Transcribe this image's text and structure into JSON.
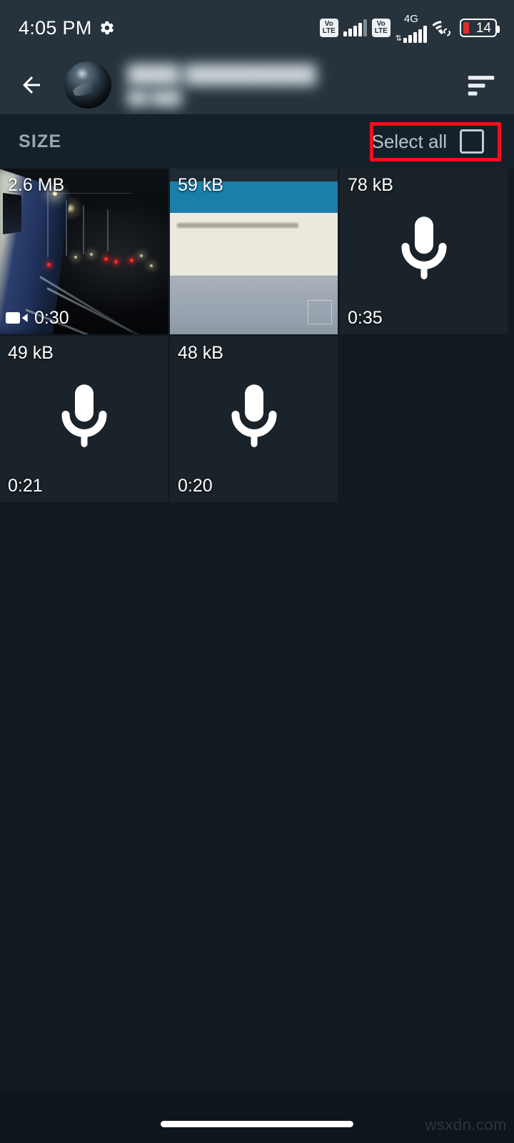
{
  "status_bar": {
    "time": "4:05 PM",
    "gear_icon": "gear-icon",
    "volte_top": "Vo",
    "volte_bottom": "LTE",
    "network_type": "4G",
    "wifi_icon": "wifi-icon",
    "battery_percent": "14"
  },
  "app_bar": {
    "back_icon": "back-arrow-icon",
    "avatar": "contact-avatar",
    "title": "",
    "subtitle": "",
    "sort_icon": "sort-icon"
  },
  "section": {
    "size_label": "SIZE",
    "select_all_label": "Select all",
    "checkbox_state": "unchecked",
    "annotation_color": "#fb0d1b"
  },
  "media": {
    "tiles": [
      {
        "size": "2.6 MB",
        "duration": "0:30",
        "kind": "video",
        "icon": "video-camera-icon"
      },
      {
        "size": "59 kB",
        "duration": "",
        "kind": "image",
        "icon": ""
      },
      {
        "size": "78 kB",
        "duration": "0:35",
        "kind": "voice",
        "icon": "microphone-icon"
      },
      {
        "size": "49 kB",
        "duration": "0:21",
        "kind": "voice",
        "icon": "microphone-icon"
      },
      {
        "size": "48 kB",
        "duration": "0:20",
        "kind": "voice",
        "icon": "microphone-icon"
      }
    ]
  },
  "footer": {
    "watermark": "wsxdn.com",
    "nav_pill": "home-gesture-pill"
  },
  "colors": {
    "page_background": "#121a21",
    "appbar_background": "#26323c",
    "section_background": "#16202a",
    "tile_background": "#1a2329",
    "accent_red": "#fb0d1b"
  }
}
